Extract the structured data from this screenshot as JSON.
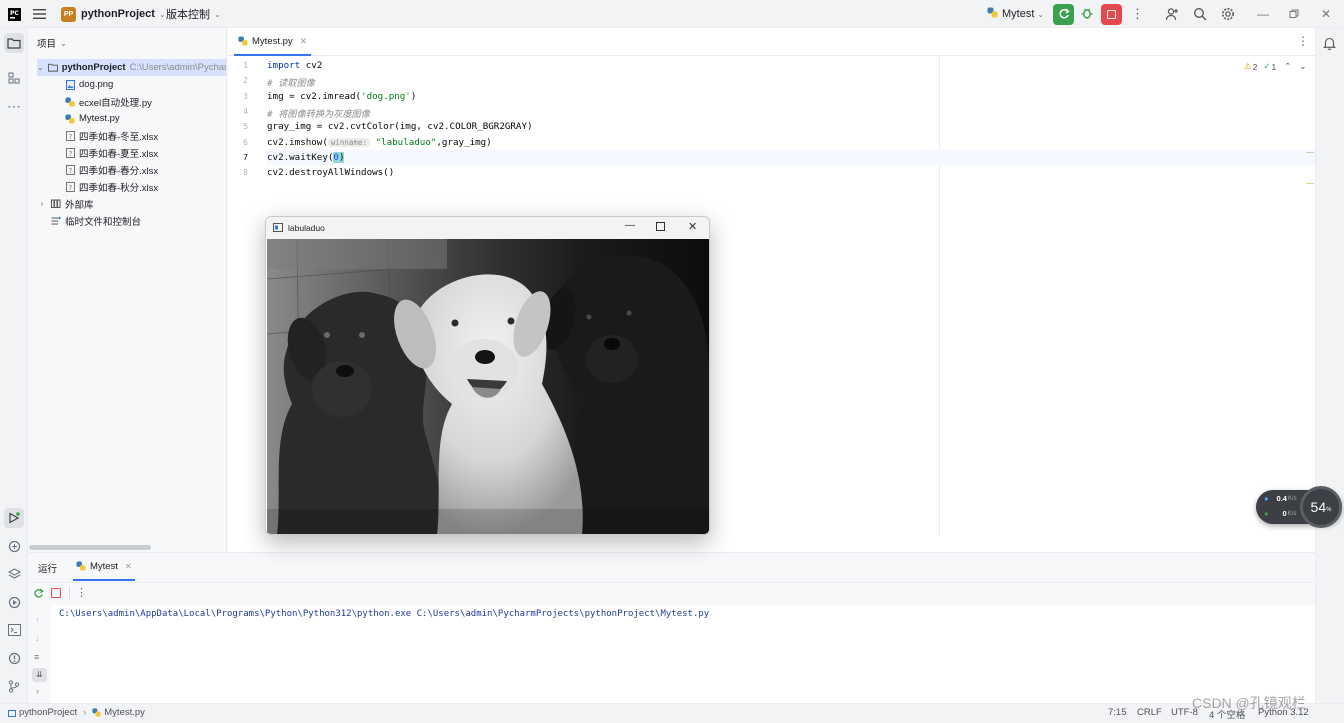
{
  "titlebar": {
    "project_badge": "PP",
    "project_name": "pythonProject",
    "vcs_label": "版本控制",
    "run_config": "Mytest"
  },
  "project_panel": {
    "title": "项目",
    "tree": [
      {
        "label": "pythonProject",
        "path": "C:\\Users\\admin\\PycharmProjects\\pythonProject",
        "kind": "folder-root"
      },
      {
        "label": "dog.png",
        "kind": "image"
      },
      {
        "label": "ecxel自动处理.py",
        "kind": "python"
      },
      {
        "label": "Mytest.py",
        "kind": "python"
      },
      {
        "label": "四季如春-冬至.xlsx",
        "kind": "xlsx"
      },
      {
        "label": "四季如春-夏至.xlsx",
        "kind": "xlsx"
      },
      {
        "label": "四季如春-春分.xlsx",
        "kind": "xlsx"
      },
      {
        "label": "四季如春-秋分.xlsx",
        "kind": "xlsx"
      },
      {
        "label": "外部库",
        "kind": "library"
      },
      {
        "label": "临时文件和控制台",
        "kind": "scratch"
      }
    ]
  },
  "editor": {
    "tab": "Mytest.py",
    "warnings": "2",
    "checks": "1",
    "line_numbers": [
      "1",
      "2",
      "3",
      "4",
      "5",
      "6",
      "7",
      "8"
    ],
    "lines": {
      "l1_kw": "import",
      "l1_rest": " cv2",
      "l2": "# 读取图像",
      "l3_a": "img = cv2.imread(",
      "l3_str": "'dog.png'",
      "l3_b": ")",
      "l4": "# 将图像转换为灰度图像",
      "l5": "gray_img = cv2.cvtColor(img, cv2.COLOR_BGR2GRAY)",
      "l6_a": "cv2.imshow(",
      "l6_hint": "winname:",
      "l6_str": "\"labuladuo\"",
      "l6_b": ",gray_img)",
      "l7_a": "cv2.waitKey(",
      "l7_num": "0",
      "l7_b": ")",
      "l8": "cv2.destroyAllWindows()"
    }
  },
  "cv_window": {
    "title": "labuladuo"
  },
  "run_panel": {
    "tab_run": "运行",
    "tab_config": "Mytest",
    "console_line": "C:\\Users\\admin\\AppData\\Local\\Programs\\Python\\Python312\\python.exe C:\\Users\\admin\\PycharmProjects\\pythonProject\\Mytest.py"
  },
  "statusbar": {
    "crumb_project": "pythonProject",
    "crumb_file": "Mytest.py",
    "position": "7:15",
    "line_sep": "CRLF",
    "encoding": "UTF-8",
    "indent": "4 个空格",
    "interpreter": "Python 3.12"
  },
  "net_widget": {
    "up": "0.4",
    "up_unit": "K/s",
    "down": "0",
    "down_unit": "K/s",
    "percent": "54",
    "percent_unit": "%"
  },
  "watermark": "CSDN @孔镜观栏",
  "colors": {
    "run_green": "#3ba150",
    "stop_red": "#e5484d",
    "accent": "#3574f0"
  }
}
